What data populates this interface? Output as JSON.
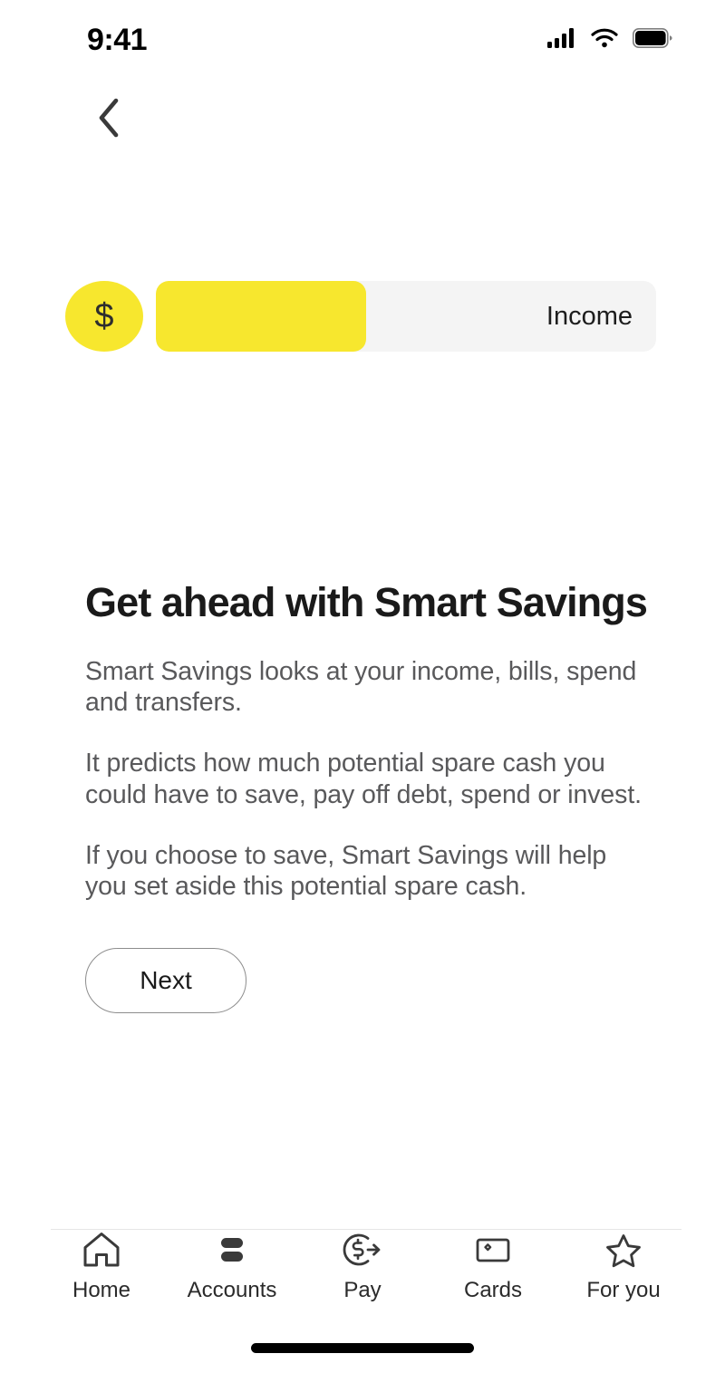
{
  "status_bar": {
    "time": "9:41",
    "cellular_icon": "cellular-signal-icon",
    "wifi_icon": "wifi-icon",
    "battery_icon": "battery-icon"
  },
  "topbar": {
    "back_icon": "back-chevron-icon"
  },
  "progress": {
    "badge_symbol": "$",
    "badge_icon": "dollar-coin-icon",
    "label": "Income",
    "fill_percent": 42,
    "fill_color": "#F7E72E",
    "track_color": "#F4F4F4",
    "badge_color": "#F7E72E"
  },
  "content": {
    "headline": "Get ahead with Smart Savings",
    "paragraphs": [
      "Smart Savings looks at your income, bills, spend and transfers.",
      "It predicts how much potential spare cash you could have to save, pay off debt, spend or invest.",
      "If you choose to save, Smart Savings will help you set aside this potential spare cash."
    ],
    "next_label": "Next"
  },
  "bottom_nav": {
    "items": [
      {
        "label": "Home",
        "icon": "home-icon"
      },
      {
        "label": "Accounts",
        "icon": "accounts-bars-icon"
      },
      {
        "label": "Pay",
        "icon": "pay-dollar-arrow-icon"
      },
      {
        "label": "Cards",
        "icon": "card-icon"
      },
      {
        "label": "For you",
        "icon": "star-icon"
      }
    ]
  }
}
